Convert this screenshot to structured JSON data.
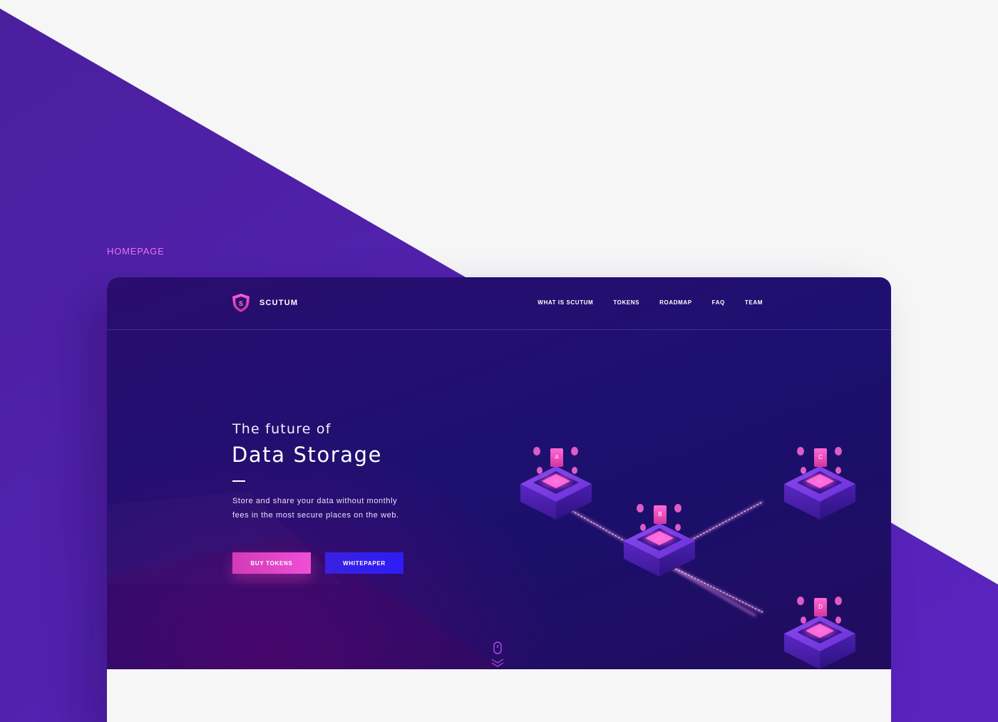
{
  "page": {
    "section_label": "HOMEPAGE",
    "accent_colors": {
      "purple": "#5a22b8",
      "pink": "#f04fd6",
      "blue": "#2d1ef5"
    }
  },
  "brand": {
    "name": "SCUTUM",
    "logo_letter": "S",
    "logo_icon": "shield-icon"
  },
  "nav": {
    "items": [
      {
        "label": "WHAT IS SCUTUM"
      },
      {
        "label": "TOKENS"
      },
      {
        "label": "ROADMAP"
      },
      {
        "label": "FAQ"
      },
      {
        "label": "TEAM"
      }
    ]
  },
  "hero": {
    "kicker": "The future of",
    "title": "Data Storage",
    "description": "Store and share your data without monthly fees in the most secure places on the web.",
    "buttons": {
      "primary": "BUY TOKENS",
      "secondary": "WHITEPAPER"
    }
  },
  "illustration": {
    "nodes": [
      {
        "letter": "A"
      },
      {
        "letter": "B"
      },
      {
        "letter": "C"
      },
      {
        "letter": "D"
      }
    ],
    "scroll_icon": "mouse-icon"
  }
}
